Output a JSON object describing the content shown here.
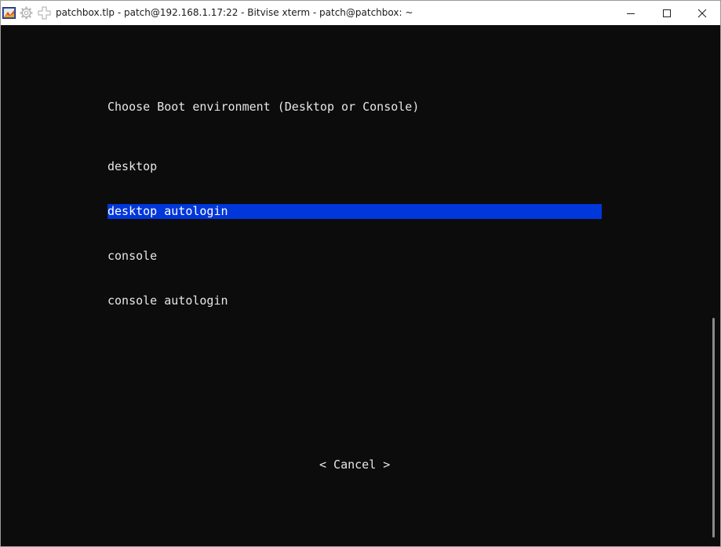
{
  "window": {
    "title": "patchbox.tlp - patch@192.168.1.17:22 - Bitvise xterm - patch@patchbox: ~",
    "icons": [
      "bitvise-app-icon",
      "gear-icon",
      "plus-icon"
    ],
    "controls": [
      "minimize-icon",
      "maximize-icon",
      "close-icon"
    ]
  },
  "terminal": {
    "prompt": "Choose Boot environment (Desktop or Console)",
    "options": [
      {
        "label": "desktop",
        "selected": false
      },
      {
        "label": "desktop autologin",
        "selected": true
      },
      {
        "label": "console",
        "selected": false
      },
      {
        "label": "console autologin",
        "selected": false
      }
    ],
    "cancel_label": "< Cancel >"
  },
  "colors": {
    "terminal_bg": "#0c0c0c",
    "terminal_fg": "#e6e6e6",
    "selection_bg": "#0037da"
  }
}
